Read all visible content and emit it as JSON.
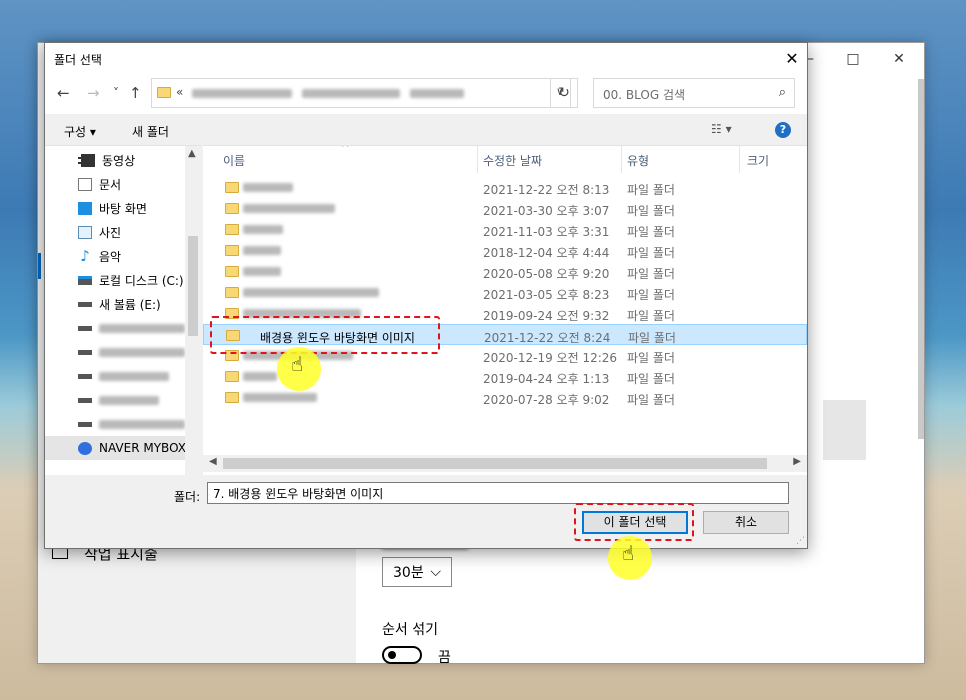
{
  "settings_window": {
    "controls": {
      "minimize": "—",
      "maximize": "□",
      "close": "✕"
    },
    "taskbar_item": "작업 표시줄",
    "interval_value": "30분",
    "shuffle_label": "순서 섞기",
    "toggle_label": "끔"
  },
  "dialog": {
    "title": "폴더 선택",
    "close_glyph": "✕",
    "nav": {
      "back": "←",
      "forward": "→",
      "recent": "˅",
      "up": "↑",
      "refresh": "↻",
      "address_chevron": "«",
      "address_dropdown": "∨"
    },
    "search": {
      "placeholder": "00. BLOG 검색"
    },
    "toolbar": {
      "organize": "구성 ▾",
      "new_folder": "새 폴더",
      "view": "☷ ▾",
      "help": "?"
    },
    "nav_pane": [
      {
        "label": "동영상",
        "icon": "video-icon"
      },
      {
        "label": "문서",
        "icon": "document-icon"
      },
      {
        "label": "바탕 화면",
        "icon": "desktop-icon"
      },
      {
        "label": "사진",
        "icon": "pictures-icon"
      },
      {
        "label": "음악",
        "icon": "music-icon"
      },
      {
        "label": "로컬 디스크 (C:)",
        "icon": "local-disk-icon"
      },
      {
        "label": "새 볼륨 (E:)",
        "icon": "drive-icon"
      },
      {
        "label": "",
        "icon": "drive-icon"
      },
      {
        "label": "",
        "icon": "drive-icon"
      },
      {
        "label": "",
        "icon": "drive-icon"
      },
      {
        "label": "",
        "icon": "drive-icon"
      },
      {
        "label": "",
        "icon": "drive-icon"
      },
      {
        "label": "NAVER MYBOX",
        "icon": "naver-mybox-icon"
      }
    ],
    "columns": {
      "name": "이름",
      "modified": "수정한 날짜",
      "type": "유형",
      "size": "크기"
    },
    "files": [
      {
        "name": "",
        "date": "2021-12-22 오전 8:13",
        "type": "파일 폴더"
      },
      {
        "name": "",
        "date": "2021-03-30 오후 3:07",
        "type": "파일 폴더"
      },
      {
        "name": "",
        "date": "2021-11-03 오후 3:31",
        "type": "파일 폴더"
      },
      {
        "name": "",
        "date": "2018-12-04 오후 4:44",
        "type": "파일 폴더"
      },
      {
        "name": "",
        "date": "2020-05-08 오후 9:20",
        "type": "파일 폴더"
      },
      {
        "name": "",
        "date": "2021-03-05 오후 8:23",
        "type": "파일 폴더"
      },
      {
        "name": "",
        "date": "2019-09-24 오전 9:32",
        "type": "파일 폴더"
      },
      {
        "name": "배경용 윈도우 바탕화면 이미지",
        "date": "2021-12-22 오전 8:24",
        "type": "파일 폴더",
        "selected": true
      },
      {
        "name": "",
        "date": "2020-12-19 오전 12:26",
        "type": "파일 폴더"
      },
      {
        "name": "",
        "date": "2019-04-24 오후 1:13",
        "type": "파일 폴더"
      },
      {
        "name": "",
        "date": "2020-07-28 오후 9:02",
        "type": "파일 폴더"
      }
    ],
    "folder_label": "폴더:",
    "folder_value": "7. 배경용 윈도우 바탕화면 이미지",
    "select_button": "이 폴더 선택",
    "cancel_button": "취소"
  }
}
